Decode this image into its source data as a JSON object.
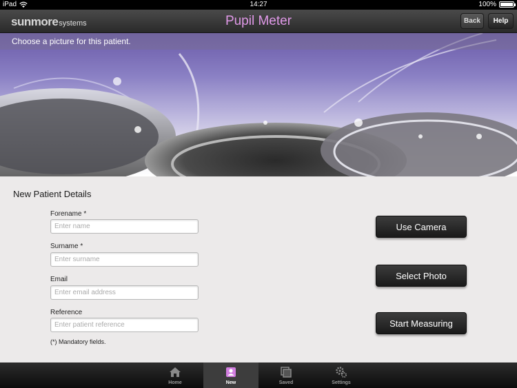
{
  "status_bar": {
    "device": "iPad",
    "time": "14:27",
    "battery": "100%"
  },
  "header": {
    "brand_primary": "sunmore",
    "brand_secondary": "systems",
    "title": "Pupil Meter",
    "back_label": "Back",
    "help_label": "Help",
    "title_color": "#e099e8"
  },
  "banner": {
    "prompt": "Choose a picture for this patient."
  },
  "form": {
    "title": "New Patient Details",
    "fields": [
      {
        "label": "Forename *",
        "placeholder": "Enter name"
      },
      {
        "label": "Surname *",
        "placeholder": "Enter surname"
      },
      {
        "label": "Email",
        "placeholder": "Enter email address"
      },
      {
        "label": "Reference",
        "placeholder": "Enter patient reference"
      }
    ],
    "mandatory_note": "(*) Mandatory fields."
  },
  "actions": {
    "use_camera": "Use Camera",
    "select_photo": "Select Photo",
    "start_measuring": "Start Measuring"
  },
  "tabbar": {
    "tabs": [
      {
        "label": "Home",
        "icon": "home-icon",
        "active": false
      },
      {
        "label": "New",
        "icon": "new-patient-icon",
        "active": true
      },
      {
        "label": "Saved",
        "icon": "saved-icon",
        "active": false
      },
      {
        "label": "Settings",
        "icon": "gears-icon",
        "active": false
      }
    ]
  }
}
